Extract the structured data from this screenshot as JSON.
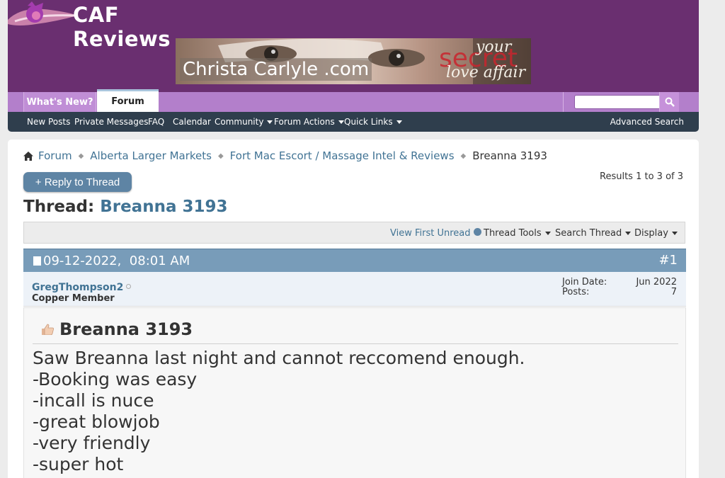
{
  "site": {
    "logo_text": "CAF Reviews"
  },
  "banner": {
    "text": "Christa Carlyle .com",
    "tag_your": "your",
    "tag_secret": "secret",
    "tag_love": "love affair"
  },
  "tabs": [
    {
      "label": "What's New?",
      "active": false
    },
    {
      "label": "Forum",
      "active": true
    }
  ],
  "search": {
    "value": "",
    "icon": "search-icon"
  },
  "nav": {
    "items": [
      {
        "label": "New Posts",
        "dropdown": false
      },
      {
        "label": "Private Messages",
        "dropdown": false
      },
      {
        "label": "FAQ",
        "dropdown": false
      },
      {
        "label": "Calendar",
        "dropdown": false
      },
      {
        "label": "Community",
        "dropdown": true
      },
      {
        "label": "Forum Actions",
        "dropdown": true
      },
      {
        "label": "Quick Links",
        "dropdown": true
      }
    ],
    "advanced_search": "Advanced Search"
  },
  "breadcrumb": {
    "items": [
      "Forum",
      "Alberta Larger Markets",
      "Fort Mac Escort / Massage Intel & Reviews"
    ],
    "current": "Breanna 3193"
  },
  "thread": {
    "reply_label": "+ Reply to Thread",
    "results": "Results 1 to 3 of 3",
    "title_prefix": "Thread:",
    "title": "Breanna 3193"
  },
  "tools": {
    "view_first_unread": "View First Unread",
    "thread_tools": "Thread Tools",
    "search_thread": "Search Thread",
    "display": "Display"
  },
  "post": {
    "date": "09-12-2022,",
    "time": "08:01 AM",
    "number": "#1",
    "username": "GregThompson2",
    "user_title": "Copper Member",
    "join_date_label": "Join Date:",
    "join_date": "Jun 2022",
    "posts_label": "Posts:",
    "posts": "7",
    "title": "Breanna 3193",
    "lines": [
      "Saw Breanna last night and cannot reccomend enough.",
      "-Booking was easy",
      "-incall is nuce",
      "-great blowjob",
      "-very friendly",
      "-super hot"
    ]
  },
  "colors": {
    "header_purple": "#6a2f70",
    "tab_purple": "#b37fcb",
    "navbar": "#2f3e4d",
    "link_blue": "#417394",
    "post_header": "#789cb9"
  }
}
